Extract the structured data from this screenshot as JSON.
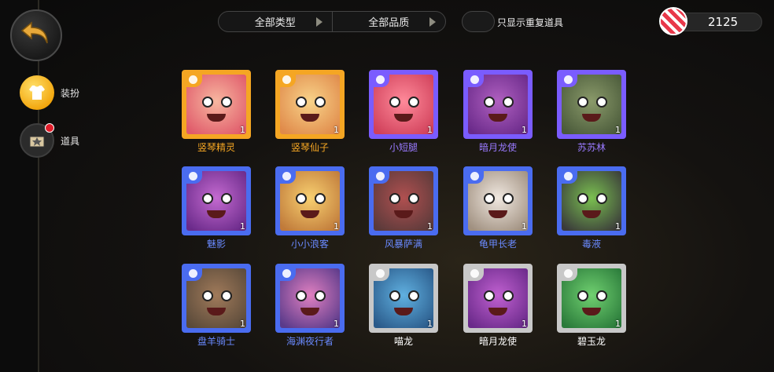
{
  "nav": {
    "back_icon": "back-arrow-icon",
    "items": [
      {
        "label": "装扮",
        "icon": "outfit-icon",
        "active": true
      },
      {
        "label": "道具",
        "icon": "item-box-icon",
        "active": false,
        "notify": true
      }
    ]
  },
  "filters": {
    "type_label": "全部类型",
    "quality_label": "全部品质",
    "duplicate_label": "只显示重复道具"
  },
  "currency": {
    "icon": "candy-icon",
    "value": "2125"
  },
  "rarity_colors": {
    "orange": "#f5a623",
    "purple": "#7a5cff",
    "blue": "#4a6cf0",
    "gray": "#c8c8c8"
  },
  "items": [
    {
      "name": "竖琴精灵",
      "count": "1",
      "rarity": "orange"
    },
    {
      "name": "竖琴仙子",
      "count": "1",
      "rarity": "orange"
    },
    {
      "name": "小短腿",
      "count": "1",
      "rarity": "purple"
    },
    {
      "name": "暗月龙使",
      "count": "1",
      "rarity": "purple"
    },
    {
      "name": "苏苏林",
      "count": "1",
      "rarity": "purple"
    },
    {
      "name": "魅影",
      "count": "1",
      "rarity": "blue"
    },
    {
      "name": "小小浪客",
      "count": "1",
      "rarity": "blue"
    },
    {
      "name": "风暴萨满",
      "count": "1",
      "rarity": "blue"
    },
    {
      "name": "龟甲长老",
      "count": "1",
      "rarity": "blue"
    },
    {
      "name": "毒液",
      "count": "1",
      "rarity": "blue"
    },
    {
      "name": "盘羊骑士",
      "count": "1",
      "rarity": "blue"
    },
    {
      "name": "海渊夜行者",
      "count": "1",
      "rarity": "blue"
    },
    {
      "name": "喵龙",
      "count": "1",
      "rarity": "gray"
    },
    {
      "name": "暗月龙使",
      "count": "1",
      "rarity": "gray"
    },
    {
      "name": "碧玉龙",
      "count": "1",
      "rarity": "gray"
    }
  ]
}
